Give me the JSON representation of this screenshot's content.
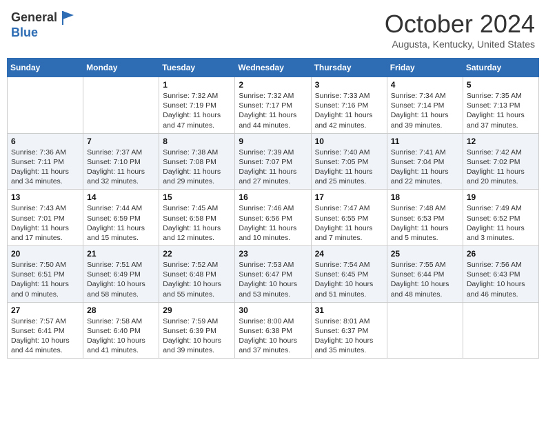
{
  "header": {
    "logo_general": "General",
    "logo_blue": "Blue",
    "month_title": "October 2024",
    "location": "Augusta, Kentucky, United States"
  },
  "weekdays": [
    "Sunday",
    "Monday",
    "Tuesday",
    "Wednesday",
    "Thursday",
    "Friday",
    "Saturday"
  ],
  "weeks": [
    [
      {
        "day": "",
        "sunrise": "",
        "sunset": "",
        "daylight": ""
      },
      {
        "day": "",
        "sunrise": "",
        "sunset": "",
        "daylight": ""
      },
      {
        "day": "1",
        "sunrise": "Sunrise: 7:32 AM",
        "sunset": "Sunset: 7:19 PM",
        "daylight": "Daylight: 11 hours and 47 minutes."
      },
      {
        "day": "2",
        "sunrise": "Sunrise: 7:32 AM",
        "sunset": "Sunset: 7:17 PM",
        "daylight": "Daylight: 11 hours and 44 minutes."
      },
      {
        "day": "3",
        "sunrise": "Sunrise: 7:33 AM",
        "sunset": "Sunset: 7:16 PM",
        "daylight": "Daylight: 11 hours and 42 minutes."
      },
      {
        "day": "4",
        "sunrise": "Sunrise: 7:34 AM",
        "sunset": "Sunset: 7:14 PM",
        "daylight": "Daylight: 11 hours and 39 minutes."
      },
      {
        "day": "5",
        "sunrise": "Sunrise: 7:35 AM",
        "sunset": "Sunset: 7:13 PM",
        "daylight": "Daylight: 11 hours and 37 minutes."
      }
    ],
    [
      {
        "day": "6",
        "sunrise": "Sunrise: 7:36 AM",
        "sunset": "Sunset: 7:11 PM",
        "daylight": "Daylight: 11 hours and 34 minutes."
      },
      {
        "day": "7",
        "sunrise": "Sunrise: 7:37 AM",
        "sunset": "Sunset: 7:10 PM",
        "daylight": "Daylight: 11 hours and 32 minutes."
      },
      {
        "day": "8",
        "sunrise": "Sunrise: 7:38 AM",
        "sunset": "Sunset: 7:08 PM",
        "daylight": "Daylight: 11 hours and 29 minutes."
      },
      {
        "day": "9",
        "sunrise": "Sunrise: 7:39 AM",
        "sunset": "Sunset: 7:07 PM",
        "daylight": "Daylight: 11 hours and 27 minutes."
      },
      {
        "day": "10",
        "sunrise": "Sunrise: 7:40 AM",
        "sunset": "Sunset: 7:05 PM",
        "daylight": "Daylight: 11 hours and 25 minutes."
      },
      {
        "day": "11",
        "sunrise": "Sunrise: 7:41 AM",
        "sunset": "Sunset: 7:04 PM",
        "daylight": "Daylight: 11 hours and 22 minutes."
      },
      {
        "day": "12",
        "sunrise": "Sunrise: 7:42 AM",
        "sunset": "Sunset: 7:02 PM",
        "daylight": "Daylight: 11 hours and 20 minutes."
      }
    ],
    [
      {
        "day": "13",
        "sunrise": "Sunrise: 7:43 AM",
        "sunset": "Sunset: 7:01 PM",
        "daylight": "Daylight: 11 hours and 17 minutes."
      },
      {
        "day": "14",
        "sunrise": "Sunrise: 7:44 AM",
        "sunset": "Sunset: 6:59 PM",
        "daylight": "Daylight: 11 hours and 15 minutes."
      },
      {
        "day": "15",
        "sunrise": "Sunrise: 7:45 AM",
        "sunset": "Sunset: 6:58 PM",
        "daylight": "Daylight: 11 hours and 12 minutes."
      },
      {
        "day": "16",
        "sunrise": "Sunrise: 7:46 AM",
        "sunset": "Sunset: 6:56 PM",
        "daylight": "Daylight: 11 hours and 10 minutes."
      },
      {
        "day": "17",
        "sunrise": "Sunrise: 7:47 AM",
        "sunset": "Sunset: 6:55 PM",
        "daylight": "Daylight: 11 hours and 7 minutes."
      },
      {
        "day": "18",
        "sunrise": "Sunrise: 7:48 AM",
        "sunset": "Sunset: 6:53 PM",
        "daylight": "Daylight: 11 hours and 5 minutes."
      },
      {
        "day": "19",
        "sunrise": "Sunrise: 7:49 AM",
        "sunset": "Sunset: 6:52 PM",
        "daylight": "Daylight: 11 hours and 3 minutes."
      }
    ],
    [
      {
        "day": "20",
        "sunrise": "Sunrise: 7:50 AM",
        "sunset": "Sunset: 6:51 PM",
        "daylight": "Daylight: 11 hours and 0 minutes."
      },
      {
        "day": "21",
        "sunrise": "Sunrise: 7:51 AM",
        "sunset": "Sunset: 6:49 PM",
        "daylight": "Daylight: 10 hours and 58 minutes."
      },
      {
        "day": "22",
        "sunrise": "Sunrise: 7:52 AM",
        "sunset": "Sunset: 6:48 PM",
        "daylight": "Daylight: 10 hours and 55 minutes."
      },
      {
        "day": "23",
        "sunrise": "Sunrise: 7:53 AM",
        "sunset": "Sunset: 6:47 PM",
        "daylight": "Daylight: 10 hours and 53 minutes."
      },
      {
        "day": "24",
        "sunrise": "Sunrise: 7:54 AM",
        "sunset": "Sunset: 6:45 PM",
        "daylight": "Daylight: 10 hours and 51 minutes."
      },
      {
        "day": "25",
        "sunrise": "Sunrise: 7:55 AM",
        "sunset": "Sunset: 6:44 PM",
        "daylight": "Daylight: 10 hours and 48 minutes."
      },
      {
        "day": "26",
        "sunrise": "Sunrise: 7:56 AM",
        "sunset": "Sunset: 6:43 PM",
        "daylight": "Daylight: 10 hours and 46 minutes."
      }
    ],
    [
      {
        "day": "27",
        "sunrise": "Sunrise: 7:57 AM",
        "sunset": "Sunset: 6:41 PM",
        "daylight": "Daylight: 10 hours and 44 minutes."
      },
      {
        "day": "28",
        "sunrise": "Sunrise: 7:58 AM",
        "sunset": "Sunset: 6:40 PM",
        "daylight": "Daylight: 10 hours and 41 minutes."
      },
      {
        "day": "29",
        "sunrise": "Sunrise: 7:59 AM",
        "sunset": "Sunset: 6:39 PM",
        "daylight": "Daylight: 10 hours and 39 minutes."
      },
      {
        "day": "30",
        "sunrise": "Sunrise: 8:00 AM",
        "sunset": "Sunset: 6:38 PM",
        "daylight": "Daylight: 10 hours and 37 minutes."
      },
      {
        "day": "31",
        "sunrise": "Sunrise: 8:01 AM",
        "sunset": "Sunset: 6:37 PM",
        "daylight": "Daylight: 10 hours and 35 minutes."
      },
      {
        "day": "",
        "sunrise": "",
        "sunset": "",
        "daylight": ""
      },
      {
        "day": "",
        "sunrise": "",
        "sunset": "",
        "daylight": ""
      }
    ]
  ]
}
